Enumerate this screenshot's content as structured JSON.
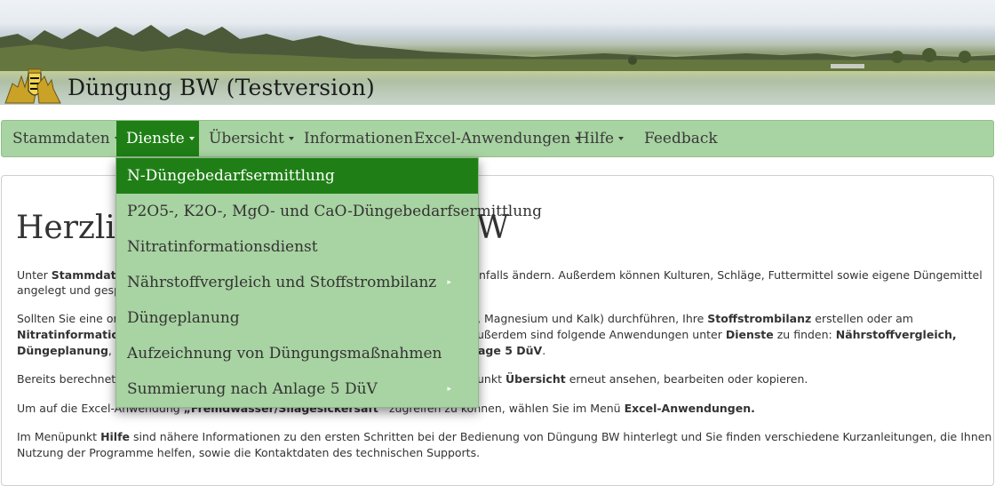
{
  "header": {
    "site_title": "Düngung BW (Testversion)",
    "logo_icon": "baden-wuerttemberg-coat-of-arms"
  },
  "navbar": {
    "items": [
      {
        "label": "Stammdaten",
        "has_caret": true
      },
      {
        "label": "Dienste",
        "has_caret": true,
        "active": true
      },
      {
        "label": "Übersicht",
        "has_caret": true
      },
      {
        "label": "Informationen",
        "has_caret": false
      },
      {
        "label": "Excel-Anwendungen",
        "has_caret": true
      },
      {
        "label": "Hilfe",
        "has_caret": true
      },
      {
        "label": "Feedback",
        "has_caret": false
      }
    ]
  },
  "dropdown": {
    "items": [
      {
        "label": "N-Düngebedarfsermittlung",
        "active": true,
        "submenu": false
      },
      {
        "label": "P2O5-, K2O-, MgO- und CaO-Düngebedarfsermittlung",
        "submenu": false
      },
      {
        "label": "Nitratinformationsdienst",
        "submenu": false
      },
      {
        "label": "Nährstoffvergleich und Stoffstrombilanz",
        "submenu": true
      },
      {
        "label": "Düngeplanung",
        "submenu": false
      },
      {
        "label": "Aufzeichnung von Düngungsmaßnahmen",
        "submenu": false
      },
      {
        "label": "Summierung nach Anlage 5 DüV",
        "submenu": true
      }
    ],
    "submenu_arrow": "▸"
  },
  "content": {
    "heading_left": "Herzlich",
    "heading_right": "W",
    "p1": {
      "a": "Unter ",
      "b_stammdaten": "Stammdaten",
      "c_right": "nfalls ändern. Außerdem können Kulturen, Schläge, Futtermittel sowie eigene Düngemittel",
      "line2": "angelegt und gesp"
    },
    "p2": {
      "a": "Sollten Sie eine on",
      "b_right": ", Magnesium und Kalk) durchführen, Ihre ",
      "b_stoff": "Stoffstrombilanz",
      "b_right2": " erstellen oder am",
      "line2_bold": "Nitratinformations",
      "line2_right": "ußerdem sind folgende Anwendungen unter ",
      "line2_dienste": "Dienste",
      "line2_right2": " zu finden: ",
      "line2_bold2": "Nährstoffvergleich,",
      "line3_bold": "Düngeplanung",
      "line3_mid": ", Au",
      "line3_right_bold": "age 5 DüV",
      "line3_end": "."
    },
    "p3": {
      "a": "Bereits berechnete",
      "b_right": "unkt ",
      "b_uebersicht": "Übersicht",
      "c_right": " erneut ansehen, bearbeiten oder kopieren."
    },
    "p4": {
      "a": "Um auf die Excel-Anwendung ",
      "b_bold": "„Fremdwasser/Silagesickersaft“",
      "c": " zugreifen zu können, wählen Sie im Menü ",
      "d_bold": "Excel-Anwendungen."
    },
    "p5": {
      "a": "Im Menüpunkt ",
      "b_hilfe": "Hilfe",
      "c": " sind nähere Informationen zu den ersten Schritten bei der Bedienung von Düngung BW hinterlegt und Sie finden verschiedene Kurzanleitungen, die Ihnen bei der",
      "line2": "Nutzung der Programme helfen, sowie die Kontaktdaten des technischen Supports."
    }
  },
  "colors": {
    "navbar_bg": "#a8d3a2",
    "active_bg": "#1f7f16",
    "text": "#333333"
  }
}
